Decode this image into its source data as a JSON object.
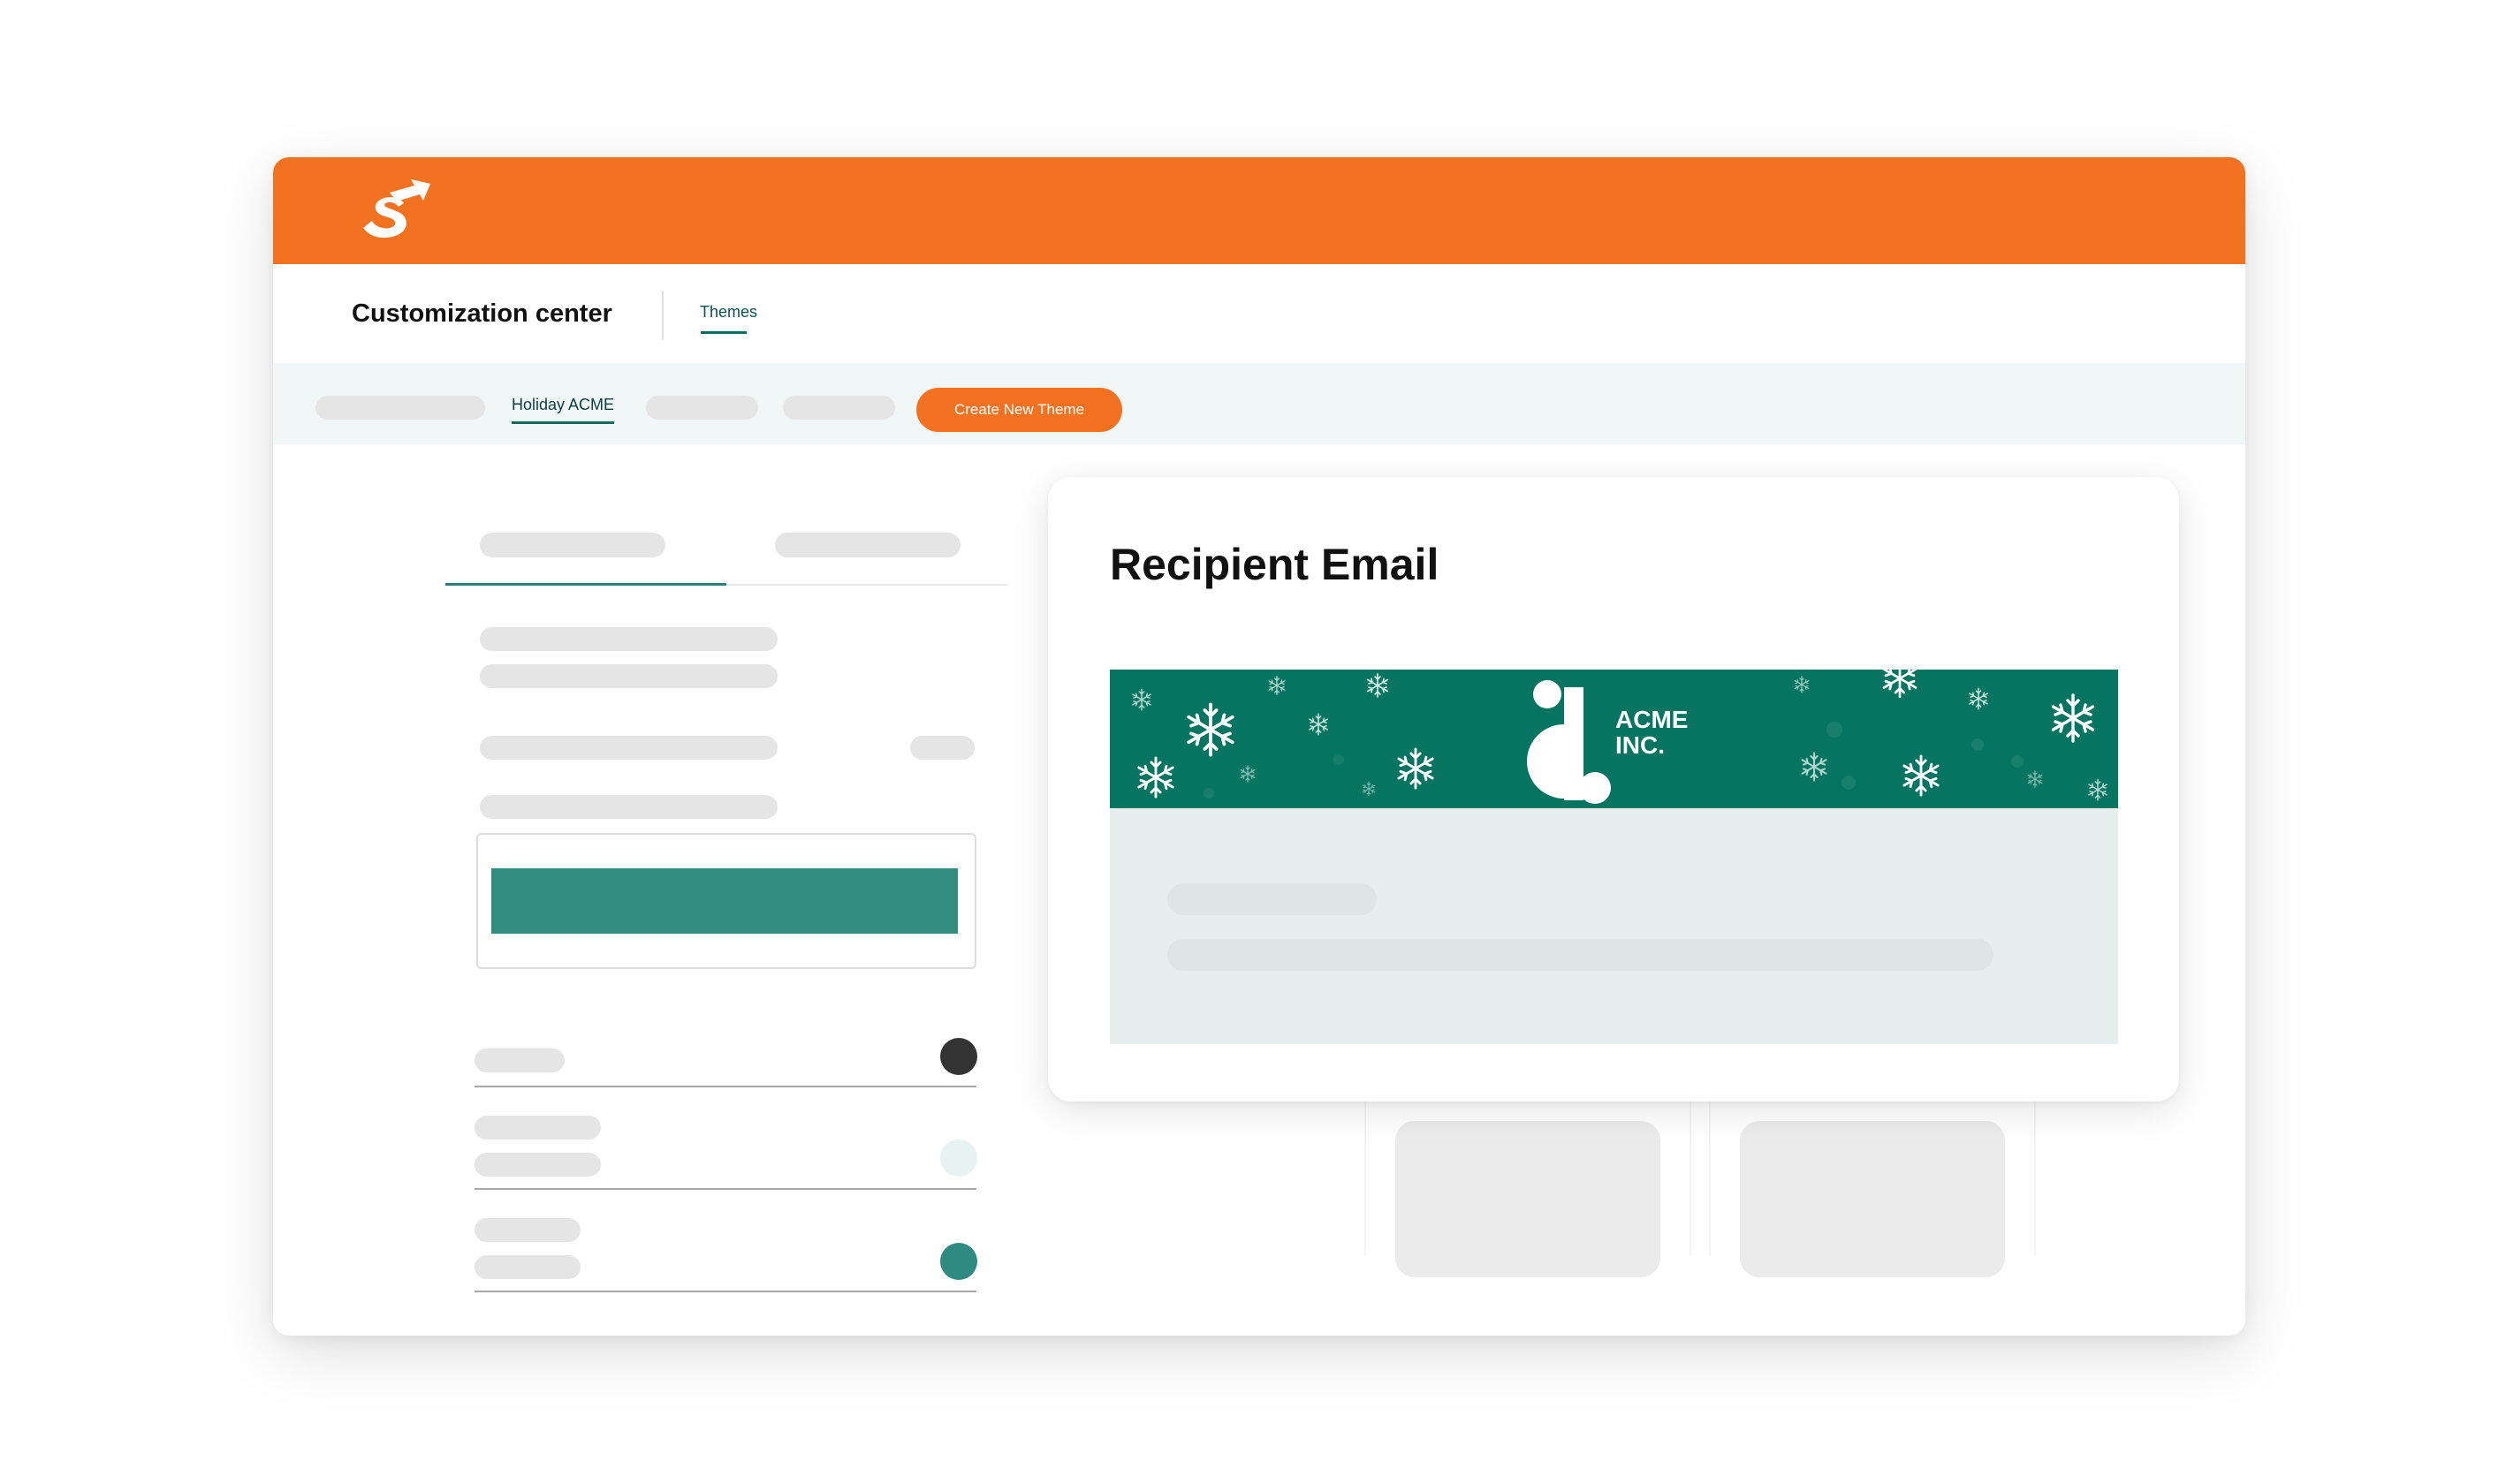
{
  "brand": {
    "accent_color": "#f37222",
    "logo_icon": "stackers-s-arrow-logo-icon"
  },
  "header": {
    "title": "Customization center",
    "tabs": [
      "Themes"
    ]
  },
  "theme_bar": {
    "active_theme": "Holiday ACME",
    "create_button": "Create New Theme"
  },
  "settings_panel": {
    "primary_color": "#348e80",
    "swatches": [
      "#333333",
      "#e7f3f0",
      "#2f8a7f"
    ]
  },
  "preview": {
    "title": "Recipient Email",
    "banner": {
      "background": "#057460",
      "logo_line1": "ACME",
      "logo_line2": "INC.",
      "decoration": "snowflake-icon"
    },
    "body_background": "#e6efed"
  }
}
